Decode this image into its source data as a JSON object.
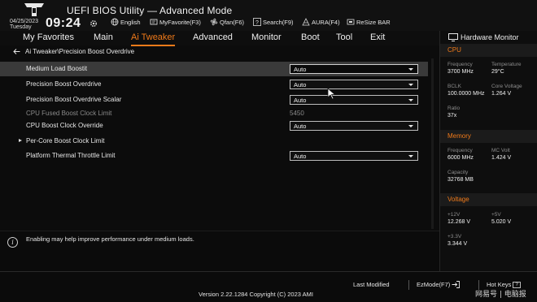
{
  "header": {
    "title": "UEFI BIOS Utility — Advanced Mode",
    "date": "04/25/2023",
    "weekday": "Tuesday",
    "time": "09:24",
    "buttons": [
      {
        "label": "English",
        "icon": "globe-icon"
      },
      {
        "label": "MyFavorite(F3)",
        "icon": "favorite-icon"
      },
      {
        "label": "Qfan(F6)",
        "icon": "fan-icon"
      },
      {
        "label": "Search(F9)",
        "icon": "search-icon"
      },
      {
        "label": "AURA(F4)",
        "icon": "aura-icon"
      },
      {
        "label": "ReSize BAR",
        "icon": "resize-bar-icon"
      }
    ]
  },
  "menu": {
    "items": [
      "My Favorites",
      "Main",
      "Ai Tweaker",
      "Advanced",
      "Monitor",
      "Boot",
      "Tool",
      "Exit"
    ],
    "active": "Ai Tweaker"
  },
  "breadcrumb": "Ai Tweaker\\Precision Boost Overdrive",
  "settings": [
    {
      "label": "Medium Load Boostit",
      "value": "Auto",
      "type": "select",
      "selected": true
    },
    {
      "label": "Precision Boost Overdrive",
      "value": "Auto",
      "type": "select"
    },
    {
      "label": "Precision Boost Overdrive Scalar",
      "value": "Auto",
      "type": "select"
    },
    {
      "label": "CPU Fused Boost Clock Limit",
      "value": "5450",
      "type": "readonly"
    },
    {
      "label": "CPU Boost Clock Override",
      "value": "Auto",
      "type": "select"
    },
    {
      "label": "Per-Core Boost Clock Limit",
      "type": "submenu"
    },
    {
      "label": "Platform Thermal Throttle Limit",
      "value": "Auto",
      "type": "select"
    }
  ],
  "help": {
    "icon": "info-icon",
    "text": "Enabling may help improve performance under medium loads."
  },
  "hardware_monitor": {
    "title": "Hardware Monitor",
    "cpu": {
      "heading": "CPU",
      "frequency_label": "Frequency",
      "frequency": "3700 MHz",
      "temperature_label": "Temperature",
      "temperature": "29°C",
      "bclk_label": "BCLK",
      "bclk": "100.0000 MHz",
      "core_voltage_label": "Core Voltage",
      "core_voltage": "1.264 V",
      "ratio_label": "Ratio",
      "ratio": "37x"
    },
    "memory": {
      "heading": "Memory",
      "frequency_label": "Frequency",
      "frequency": "6000 MHz",
      "mc_volt_label": "MC Volt",
      "mc_volt": "1.424 V",
      "capacity_label": "Capacity",
      "capacity": "32768 MB"
    },
    "voltage": {
      "heading": "Voltage",
      "v12_label": "+12V",
      "v12": "12.268 V",
      "v5_label": "+5V",
      "v5": "5.020 V",
      "v33_label": "+3.3V",
      "v33": "3.344 V"
    }
  },
  "footer": {
    "version": "Version 2.22.1284 Copyright (C) 2023 AMI",
    "last_modified": "Last Modified",
    "ezmode": "EzMode(F7)",
    "hotkeys": "Hot Keys",
    "hotkeys_key": "?",
    "watermark": "网易号 | 电脑报"
  },
  "colors": {
    "accent": "#f07a1a",
    "background": "#0c0c0c",
    "selected_row": "#3a3a3a"
  }
}
